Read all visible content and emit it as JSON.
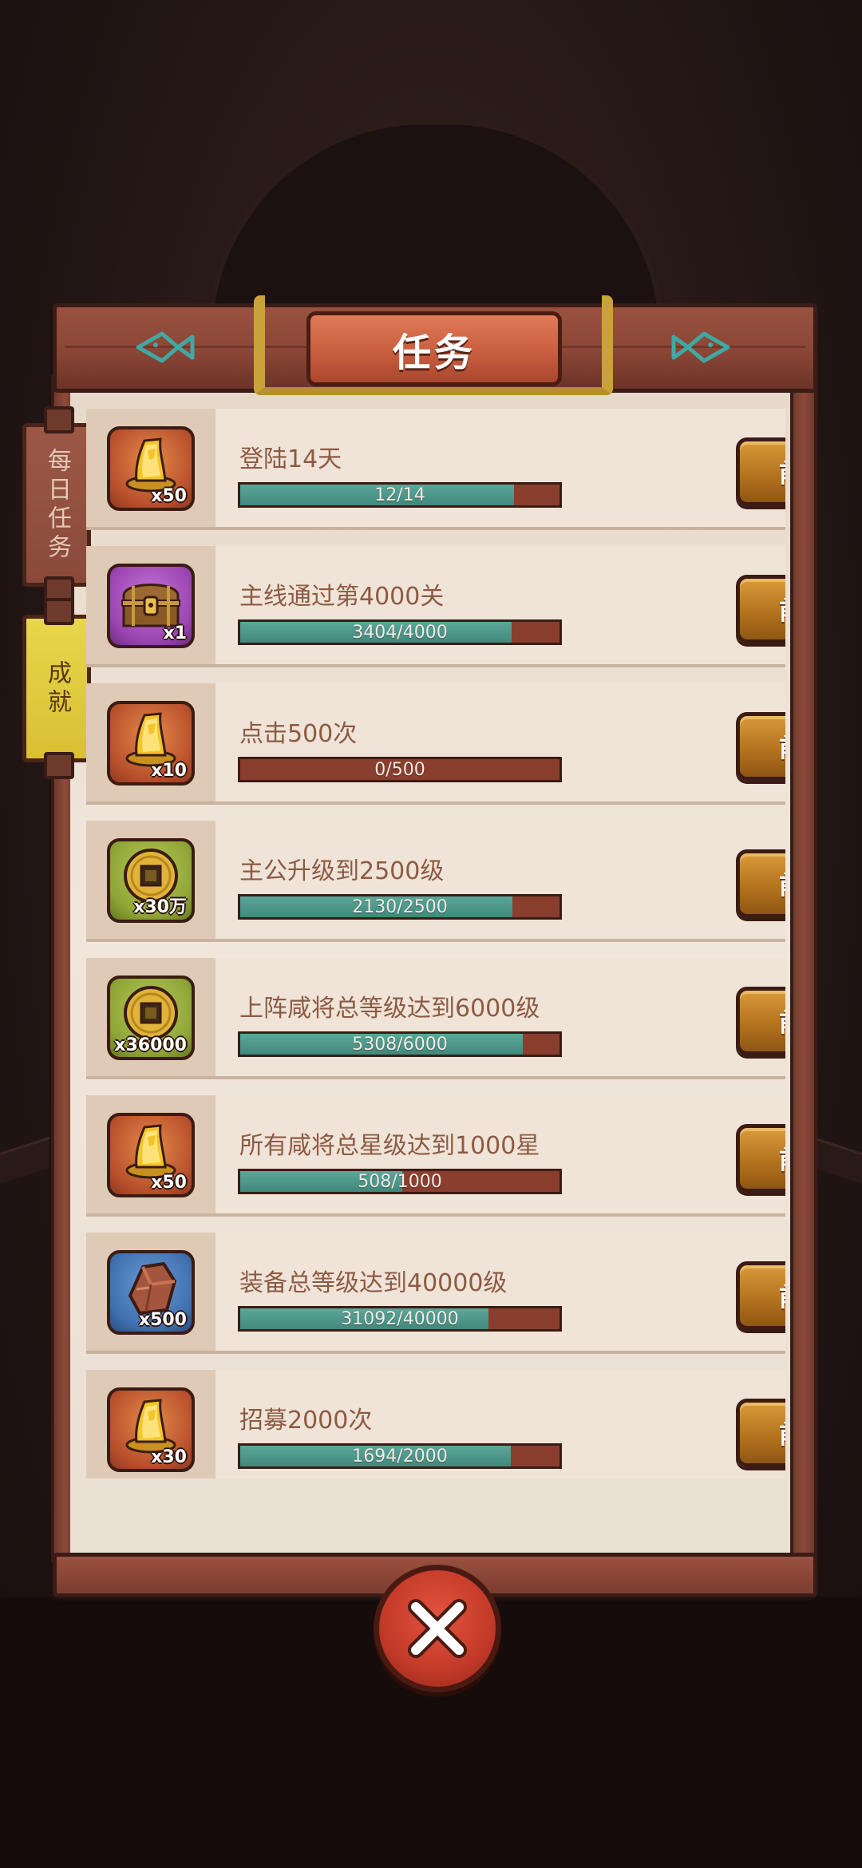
{
  "header": {
    "title": "任务"
  },
  "tabs": {
    "daily": "每日任务",
    "achievement": "成就",
    "active": "achievement"
  },
  "quests": [
    {
      "title": "登陆14天",
      "current": 12,
      "total": 14,
      "progress_text": "12/14",
      "reward_icon": "gold-ingot-icon",
      "reward_qty": "x50",
      "reward_color": "orange",
      "button": "前往"
    },
    {
      "title": "主线通过第4000关",
      "current": 3404,
      "total": 4000,
      "progress_text": "3404/4000",
      "reward_icon": "treasure-chest-icon",
      "reward_qty": "x1",
      "reward_color": "purple",
      "button": "前往"
    },
    {
      "title": "点击500次",
      "current": 0,
      "total": 500,
      "progress_text": "0/500",
      "reward_icon": "gold-ingot-icon",
      "reward_qty": "x10",
      "reward_color": "orange",
      "button": "前往"
    },
    {
      "title": "主公升级到2500级",
      "current": 2130,
      "total": 2500,
      "progress_text": "2130/2500",
      "reward_icon": "copper-coin-icon",
      "reward_qty": "x30万",
      "reward_color": "green",
      "button": "前往"
    },
    {
      "title": "上阵咸将总等级达到6000级",
      "current": 5308,
      "total": 6000,
      "progress_text": "5308/6000",
      "reward_icon": "copper-coin-icon",
      "reward_qty": "x36000",
      "reward_color": "green",
      "button": "前往"
    },
    {
      "title": "所有咸将总星级达到1000星",
      "current": 508,
      "total": 1000,
      "progress_text": "508/1000",
      "reward_icon": "gold-ingot-icon",
      "reward_qty": "x50",
      "reward_color": "orange",
      "button": "前往"
    },
    {
      "title": "装备总等级达到40000级",
      "current": 31092,
      "total": 40000,
      "progress_text": "31092/40000",
      "reward_icon": "ore-stone-icon",
      "reward_qty": "x500",
      "reward_color": "blue",
      "button": "前往"
    },
    {
      "title": "招募2000次",
      "current": 1694,
      "total": 2000,
      "progress_text": "1694/2000",
      "reward_icon": "gold-ingot-icon",
      "reward_qty": "x30",
      "reward_color": "orange",
      "button": "前往"
    }
  ],
  "colors": {
    "progress_fill": "#41887c",
    "progress_track": "#8a3e2e",
    "button": "#b5731f",
    "close": "#c33a28"
  }
}
